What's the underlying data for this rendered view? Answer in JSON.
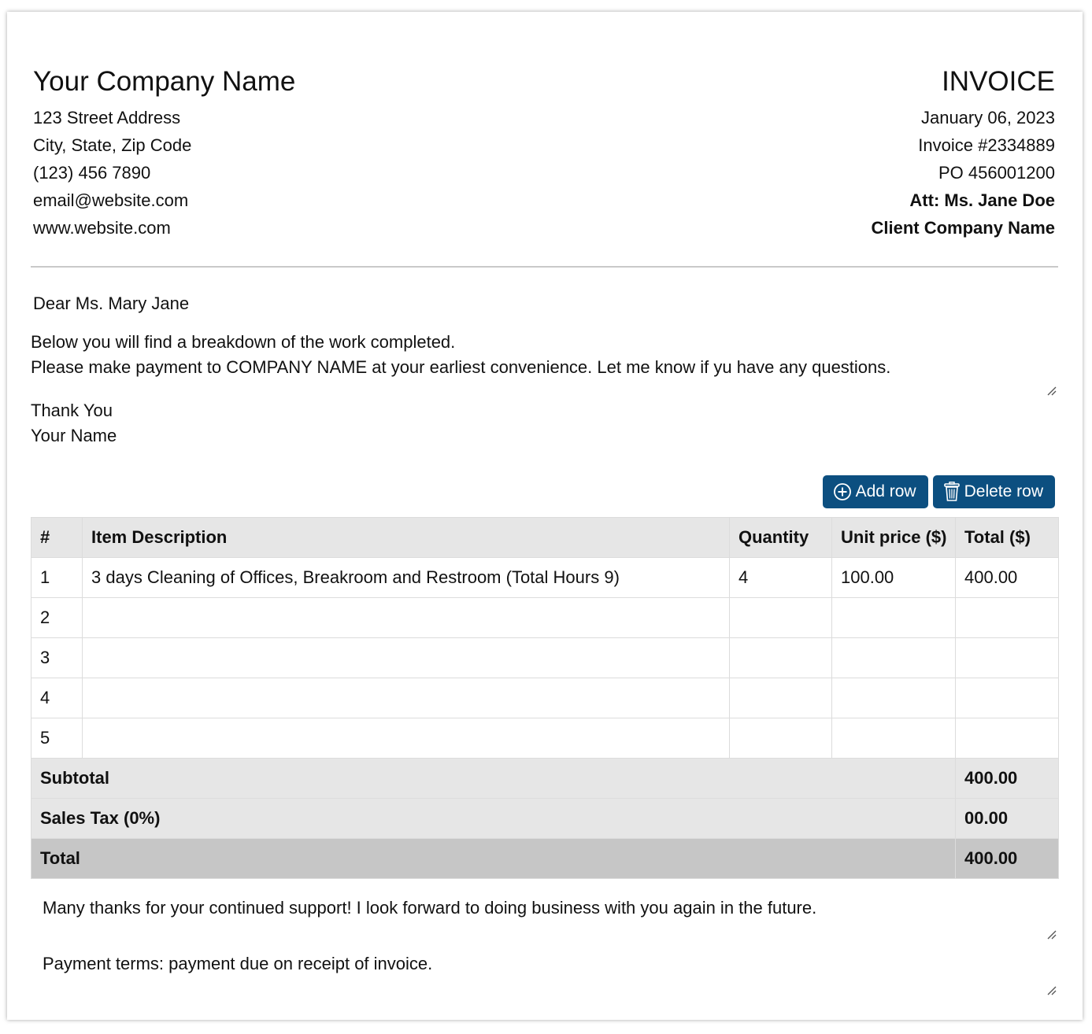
{
  "sender": {
    "company_name": "Your Company Name",
    "street": "123 Street Address",
    "city": "City, State, Zip Code",
    "phone": "(123) 456 7890",
    "email": "email@website.com",
    "website": "www.website.com"
  },
  "invoice": {
    "title": "INVOICE",
    "date": "January 06, 2023",
    "number": "Invoice #2334889",
    "po": "PO 456001200",
    "attention": "Att: Ms. Jane Doe",
    "client_company": "Client Company Name"
  },
  "letter": {
    "greeting": "Dear Ms. Mary Jane",
    "intro_line1": "Below you will find a breakdown of the work completed.",
    "intro_line2": "Please make payment to COMPANY NAME at your earliest convenience. Let me know if yu have any questions.",
    "closing_line1": "Thank You",
    "closing_line2": "Your Name"
  },
  "toolbar": {
    "add_row_label": "Add row",
    "delete_row_label": "Delete row",
    "add_icon": "plus-circle-icon",
    "delete_icon": "trash-icon",
    "button_color": "#0c4f80"
  },
  "table": {
    "headers": [
      "#",
      "Item Description",
      "Quantity",
      "Unit price ($)",
      "Total ($)"
    ],
    "rows": [
      [
        "1",
        "3 days Cleaning of Offices, Breakroom and Restroom (Total Hours 9)",
        "4",
        "100.00",
        "400.00"
      ],
      [
        "2",
        "",
        "",
        "",
        ""
      ],
      [
        "3",
        "",
        "",
        "",
        ""
      ],
      [
        "4",
        "",
        "",
        "",
        ""
      ],
      [
        "5",
        "",
        "",
        "",
        ""
      ]
    ],
    "subtotal_label": "Subtotal",
    "subtotal_value": "400.00",
    "tax_label": "Sales Tax (0%)",
    "tax_value": "00.00",
    "total_label": "Total",
    "total_value": "400.00"
  },
  "footer": {
    "thanks": "Many thanks for your continued support! I look forward to doing business with you again in the future.",
    "terms": "Payment terms: payment due on receipt of invoice."
  }
}
